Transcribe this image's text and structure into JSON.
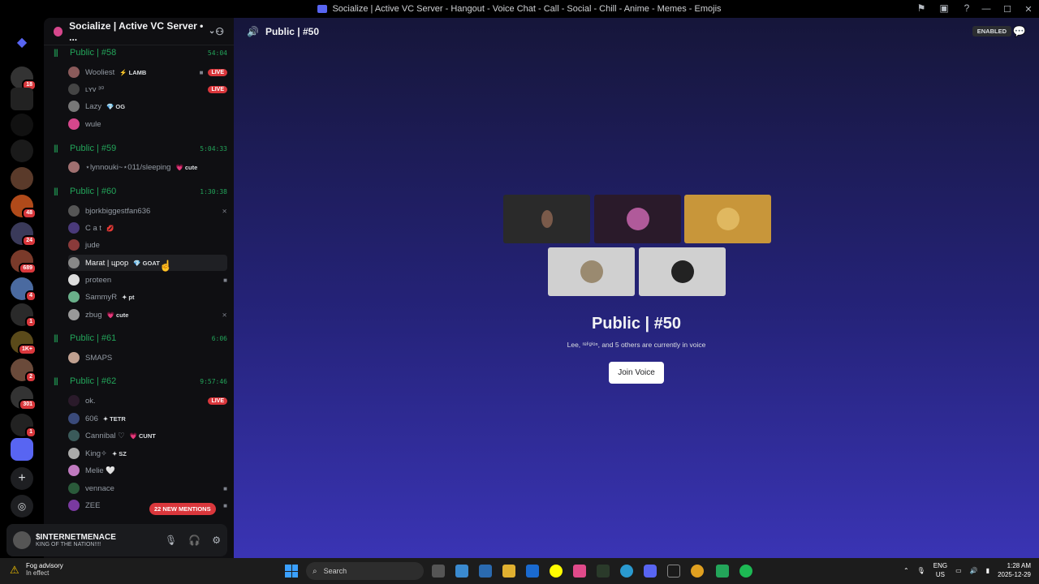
{
  "window": {
    "title": "Socialize | Active VC Server - Hangout - Voice Chat - Call - Social - Chill - Anime - Memes - Emojis",
    "controls": [
      "—",
      "☐",
      "✕"
    ]
  },
  "server_rail": {
    "badges": [
      "18",
      "48",
      "24",
      "689",
      "4",
      "1",
      "1K+",
      "2",
      "301",
      "1"
    ]
  },
  "sidebar": {
    "server_name": "Socialize | Active VC Server • ...",
    "channels": [
      {
        "name": "Public | #58",
        "timer": "54:04",
        "users": [
          {
            "name": "Wooliest",
            "tag": "LAMB",
            "tag_icon": "⚡",
            "live": "LIVE",
            "cam": true
          },
          {
            "name": "ʟʏᴠ ³⁰",
            "live": "LIVE"
          },
          {
            "name": "Lazy",
            "tag": "OG",
            "tag_icon": "💎"
          },
          {
            "name": "wule"
          }
        ]
      },
      {
        "name": "Public | #59",
        "timer": "5:04:33",
        "users": [
          {
            "name": "⋆lynnouki~⋆011/sleeping",
            "tag": "cute",
            "tag_icon": "💗"
          }
        ]
      },
      {
        "name": "Public | #60",
        "timer": "1:30:38",
        "users": [
          {
            "name": "bjorkbiggestfan636",
            "deafened": true
          },
          {
            "name": "C a t",
            "tag_icon": "💋"
          },
          {
            "name": "jude"
          },
          {
            "name": "Marat | црор",
            "tag": "GOAT",
            "tag_icon": "💎"
          },
          {
            "name": "proteen",
            "cam": true
          },
          {
            "name": "SammyR",
            "tag": "pt",
            "tag_icon": "✦"
          },
          {
            "name": "zbug",
            "tag": "cute",
            "tag_icon": "💗",
            "deafened": true
          }
        ]
      },
      {
        "name": "Public | #61",
        "timer": "6:06",
        "users": [
          {
            "name": "SMAPS"
          }
        ]
      },
      {
        "name": "Public | #62",
        "timer": "9:57:46",
        "users": [
          {
            "name": "ok.",
            "live": "LIVE"
          },
          {
            "name": "606",
            "tag": "TETR",
            "tag_icon": "✦"
          },
          {
            "name": "Cannibal ♡",
            "tag": "CUNT",
            "tag_icon": "💗"
          },
          {
            "name": "King✧",
            "tag": "SZ",
            "tag_icon": "✦"
          },
          {
            "name": "Melie 🤍"
          },
          {
            "name": "vennace",
            "cam": true
          },
          {
            "name": "ZEE",
            "cam": true
          }
        ]
      }
    ],
    "new_mentions": "22 NEW MENTIONS"
  },
  "user_panel": {
    "name": "$INTERNETMENACE",
    "status": "KING OF THE NATION!!!!"
  },
  "main": {
    "channel_title": "Public | #50",
    "enabled_label": "ENABLED",
    "vc_title": "Public | #50",
    "vc_subtitle": "Lee, ʳᵉˡⁱᵍⁱᵒⁿ, and 5 others are currently in voice",
    "join_label": "Join Voice"
  },
  "taskbar": {
    "weather_title": "Fog advisory",
    "weather_sub": "In effect",
    "search_placeholder": "Search",
    "lang1": "ENG",
    "lang2": "US",
    "time": "1:28 AM",
    "date": "2025-12-29"
  },
  "colors": {
    "accent": "#5865f2",
    "voice_green": "#23a55a",
    "live_red": "#da373c"
  }
}
